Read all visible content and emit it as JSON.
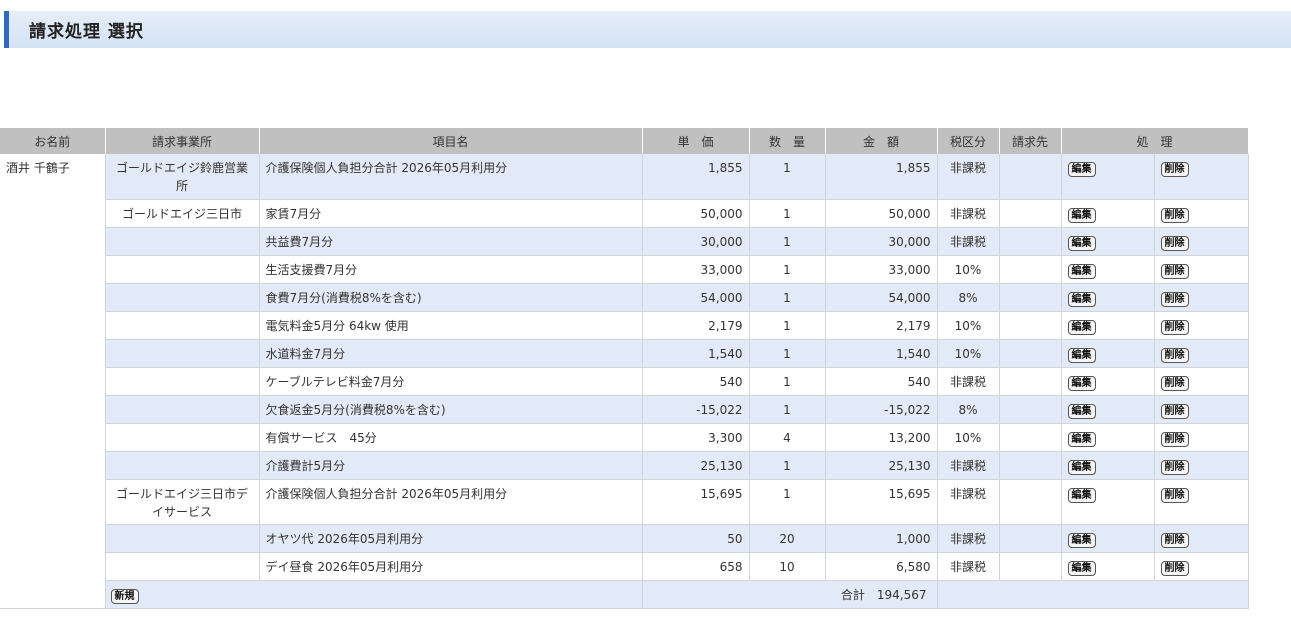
{
  "header": {
    "title": "請求処理 選択"
  },
  "table": {
    "columns": [
      "お名前",
      "請求事業所",
      "項目名",
      "単　価",
      "数　量",
      "金　額",
      "税区分",
      "請求先",
      "処　理"
    ],
    "customer_name": "酒井 千鶴子",
    "edit_label": "編集",
    "delete_label": "削除",
    "new_label": "新規",
    "total_label": "合計",
    "total_value": "194,567",
    "rows": [
      {
        "office": "ゴールドエイジ鈴鹿営業所",
        "item": "介護保険個人負担分合計 2026年05月利用分",
        "unit_price": "1,855",
        "qty": "1",
        "amount": "1,855",
        "tax": "非課税",
        "billto": ""
      },
      {
        "office": "ゴールドエイジ三日市",
        "item": "家賃7月分",
        "unit_price": "50,000",
        "qty": "1",
        "amount": "50,000",
        "tax": "非課税",
        "billto": ""
      },
      {
        "office": "",
        "item": "共益費7月分",
        "unit_price": "30,000",
        "qty": "1",
        "amount": "30,000",
        "tax": "非課税",
        "billto": ""
      },
      {
        "office": "",
        "item": "生活支援費7月分",
        "unit_price": "33,000",
        "qty": "1",
        "amount": "33,000",
        "tax": "10%",
        "billto": ""
      },
      {
        "office": "",
        "item": "食費7月分(消費税8%を含む)",
        "unit_price": "54,000",
        "qty": "1",
        "amount": "54,000",
        "tax": "8%",
        "billto": ""
      },
      {
        "office": "",
        "item": "電気料金5月分 64kw 使用",
        "unit_price": "2,179",
        "qty": "1",
        "amount": "2,179",
        "tax": "10%",
        "billto": ""
      },
      {
        "office": "",
        "item": "水道料金7月分",
        "unit_price": "1,540",
        "qty": "1",
        "amount": "1,540",
        "tax": "10%",
        "billto": ""
      },
      {
        "office": "",
        "item": "ケーブルテレビ料金7月分",
        "unit_price": "540",
        "qty": "1",
        "amount": "540",
        "tax": "非課税",
        "billto": ""
      },
      {
        "office": "",
        "item": "欠食返金5月分(消費税8%を含む)",
        "unit_price": "-15,022",
        "qty": "1",
        "amount": "-15,022",
        "tax": "8%",
        "billto": ""
      },
      {
        "office": "",
        "item": "有償サービス　45分",
        "unit_price": "3,300",
        "qty": "4",
        "amount": "13,200",
        "tax": "10%",
        "billto": ""
      },
      {
        "office": "",
        "item": "介護費計5月分",
        "unit_price": "25,130",
        "qty": "1",
        "amount": "25,130",
        "tax": "非課税",
        "billto": ""
      },
      {
        "office": "ゴールドエイジ三日市デイサービス",
        "item": "介護保険個人負担分合計 2026年05月利用分",
        "unit_price": "15,695",
        "qty": "1",
        "amount": "15,695",
        "tax": "非課税",
        "billto": ""
      },
      {
        "office": "",
        "item": "オヤツ代 2026年05月利用分",
        "unit_price": "50",
        "qty": "20",
        "amount": "1,000",
        "tax": "非課税",
        "billto": ""
      },
      {
        "office": "",
        "item": "デイ昼食 2026年05月利用分",
        "unit_price": "658",
        "qty": "10",
        "amount": "6,580",
        "tax": "非課税",
        "billto": ""
      }
    ]
  },
  "colors": {
    "header_accent": "#2e6bc4",
    "row_alt": "#e3eaf7",
    "table_head": "#c0c0c0"
  }
}
